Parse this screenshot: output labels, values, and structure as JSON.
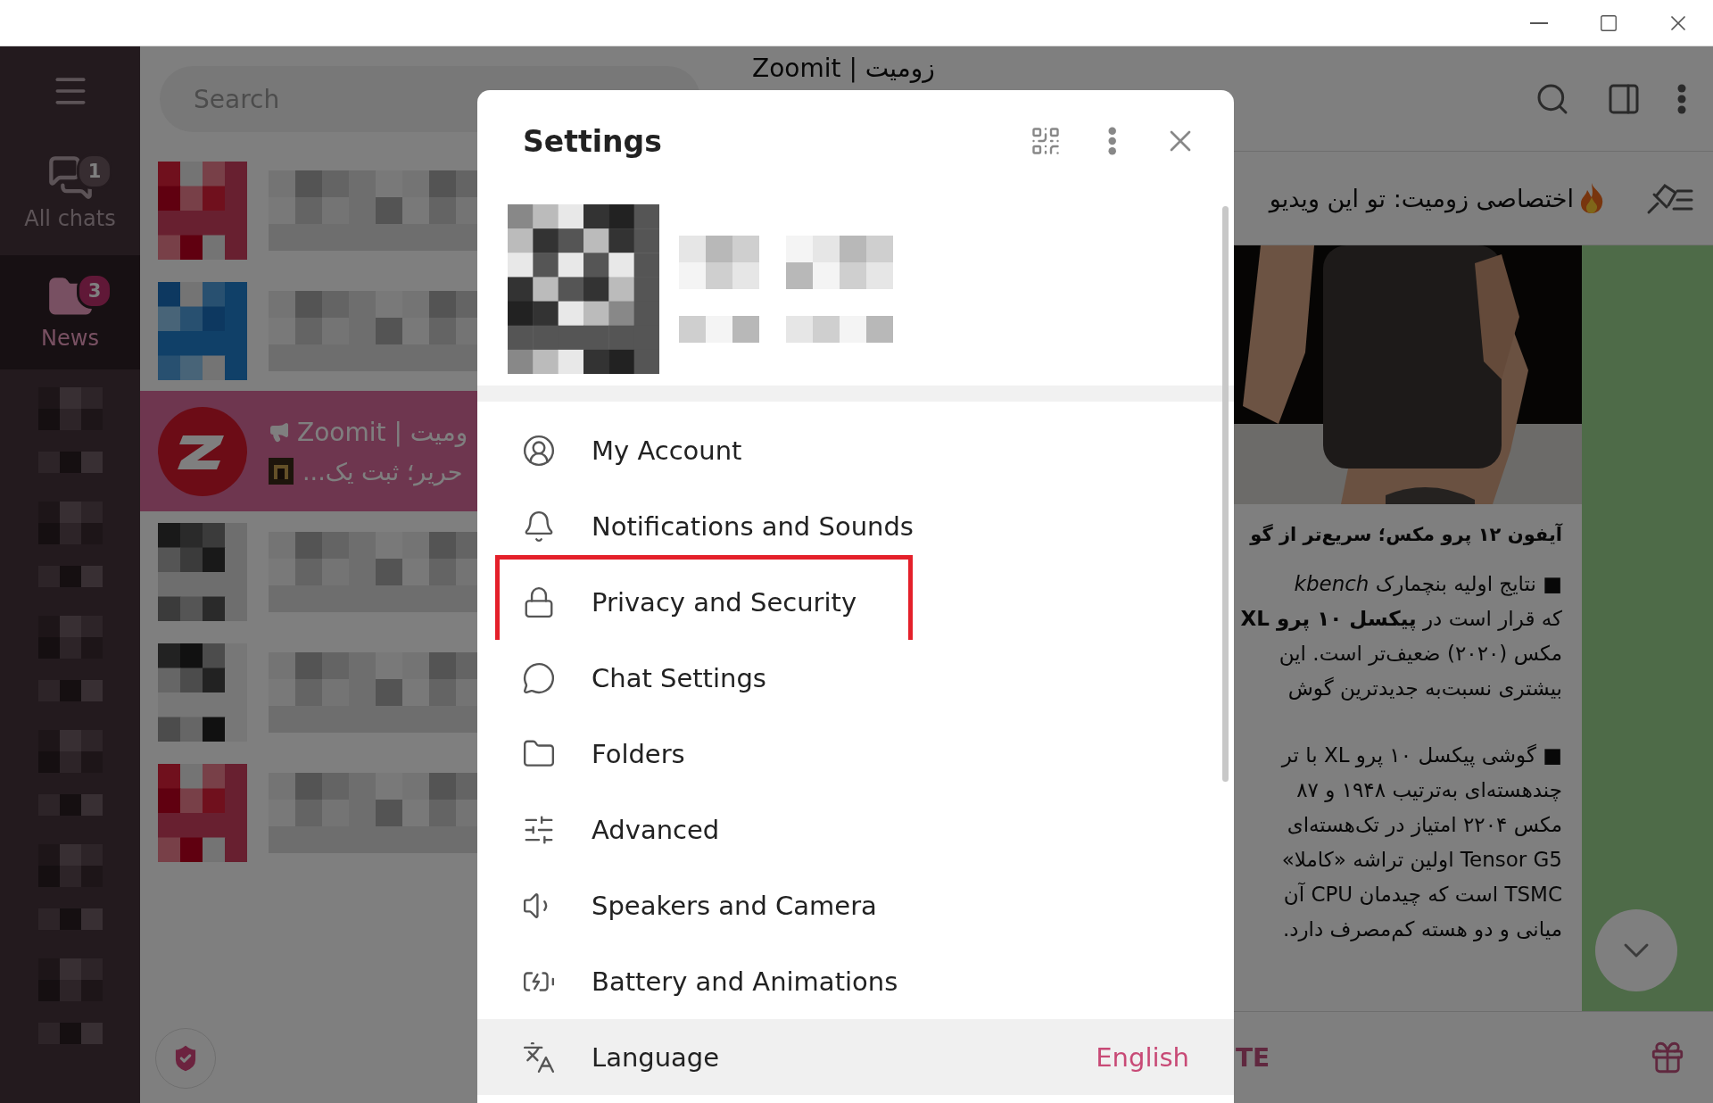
{
  "folders": {
    "items": [
      {
        "label": "All chats",
        "badge": "1",
        "selected": false
      },
      {
        "label": "News",
        "badge": "3",
        "selected": true
      }
    ],
    "hidden": [
      {
        "kind": "picture"
      },
      {
        "kind": "picture"
      },
      {
        "kind": "picture"
      },
      {
        "kind": "picture"
      },
      {
        "kind": "picture"
      },
      {
        "kind": "picture"
      }
    ]
  },
  "chat_list": {
    "search": {
      "placeholder": "Search"
    },
    "chats": [
      {
        "kind": "picture",
        "selected": false
      },
      {
        "kind": "picture",
        "selected": false
      },
      {
        "kind": "channel",
        "name": "Zoomit | ومیت",
        "preview": "حریر؛ ثبت یک...",
        "selected": true
      },
      {
        "kind": "picture",
        "selected": false
      },
      {
        "kind": "picture",
        "selected": false
      },
      {
        "kind": "picture",
        "selected": false
      }
    ]
  },
  "chat": {
    "title": "Zoomit | زومیت",
    "pinned": "اختصاصی زومیت: تو این ویدیو",
    "message": {
      "title": "آیفون ۱۲ پرو مکس؛ سریع‌تر از گو",
      "paragraphs": [
        [
          "■ نتایج اولیه بنچمارک *kbench*",
          "که قرار است در **پیکسل ۱۰ پرو XL**",
          "مکس (۲۰۲۰) ضعیف‌تر است. این",
          "بیشتری نسبت‌به جدیدترین گوش"
        ],
        [
          "■ گوشی پیکسل ۱۰ پرو XL با تر",
          "چندهسته‌ای به‌ترتیب ۱۹۴۸ و ۸۷",
          "مکس ۲۲۰۴ امتیاز در تک‌هسته‌ای",
          "Tensor G5 اولین تراشه «کاملا»",
          "TSMC است که چیدمان CPU آن",
          "میانی و دو هسته کم‌مصرف دارد."
        ]
      ]
    },
    "bottom_label": "TE"
  },
  "settings": {
    "title": "Settings",
    "items": [
      {
        "kind": "account",
        "label": "My Account",
        "highlighted": false,
        "hovered": false
      },
      {
        "kind": "notifications",
        "label": "Notifications and Sounds",
        "highlighted": false,
        "hovered": false
      },
      {
        "kind": "privacy",
        "label": "Privacy and Security",
        "highlighted": true,
        "hovered": false
      },
      {
        "kind": "chat",
        "label": "Chat Settings",
        "highlighted": false,
        "hovered": false
      },
      {
        "kind": "folders",
        "label": "Folders",
        "highlighted": false,
        "hovered": false
      },
      {
        "kind": "advanced",
        "label": "Advanced",
        "highlighted": false,
        "hovered": false
      },
      {
        "kind": "speakers",
        "label": "Speakers and Camera",
        "highlighted": false,
        "hovered": false
      },
      {
        "kind": "battery",
        "label": "Battery and Animations",
        "highlighted": false,
        "hovered": false
      },
      {
        "kind": "language",
        "label": "Language",
        "value": "English",
        "highlighted": false,
        "hovered": true
      }
    ]
  }
}
